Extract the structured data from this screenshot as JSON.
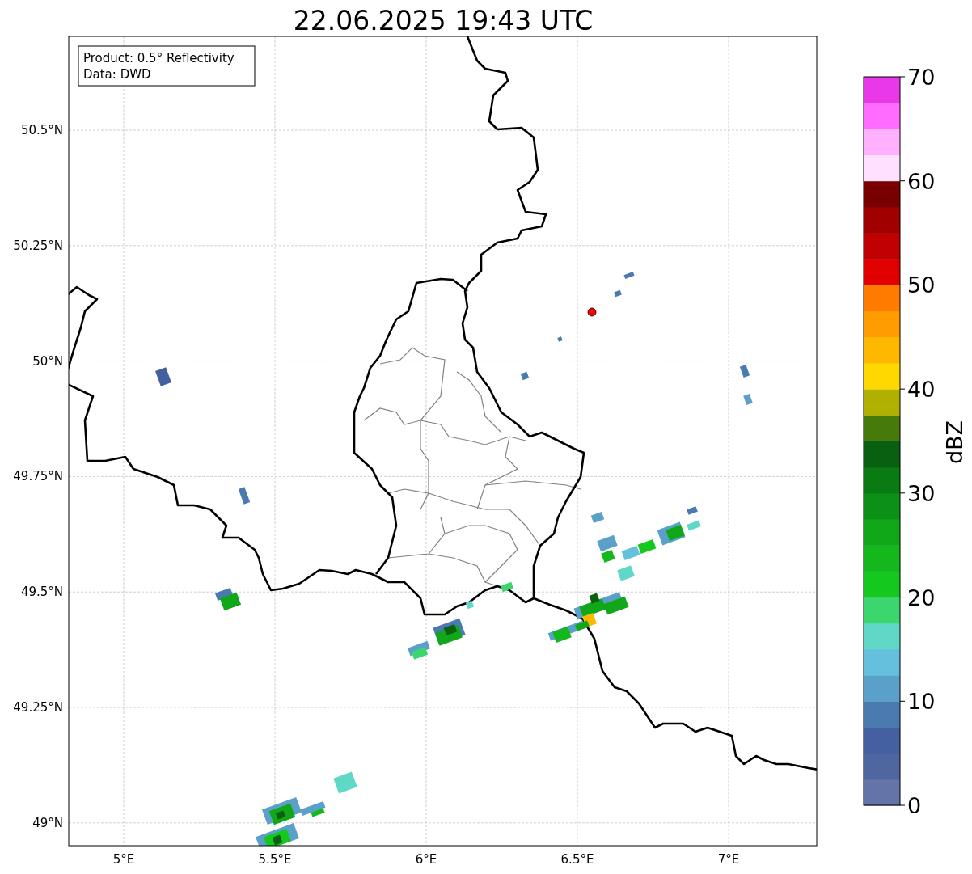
{
  "title": "22.06.2025 19:43 UTC",
  "info_box": [
    "Product: 0.5° Reflectivity",
    "Data: DWD"
  ],
  "lon_ticks": [
    "5°E",
    "5.5°E",
    "6°E",
    "6.5°E",
    "7°E"
  ],
  "lat_ticks": [
    "50.5°N",
    "50.25°N",
    "50°N",
    "49.75°N",
    "49.5°N",
    "49.25°N",
    "49°N"
  ],
  "colorbar": {
    "label": "dBZ",
    "ticks": [
      "70",
      "60",
      "50",
      "40",
      "30",
      "20",
      "10",
      "0"
    ],
    "segments": [
      {
        "color": "#6473a8"
      },
      {
        "color": "#5066a0"
      },
      {
        "color": "#4460a0"
      },
      {
        "color": "#4a7ab0"
      },
      {
        "color": "#5aa0c8"
      },
      {
        "color": "#64c0dc"
      },
      {
        "color": "#60d8c8"
      },
      {
        "color": "#3cd66e"
      },
      {
        "color": "#14c81e"
      },
      {
        "color": "#12b81c"
      },
      {
        "color": "#10a818"
      },
      {
        "color": "#0c9018"
      },
      {
        "color": "#0a7a12"
      },
      {
        "color": "#086010"
      },
      {
        "color": "#467a0a"
      },
      {
        "color": "#b0b000"
      },
      {
        "color": "#ffd800"
      },
      {
        "color": "#ffb800"
      },
      {
        "color": "#ff9c00"
      },
      {
        "color": "#ff7c00"
      },
      {
        "color": "#e00000"
      },
      {
        "color": "#c00000"
      },
      {
        "color": "#a00000"
      },
      {
        "color": "#780000"
      },
      {
        "color": "#ffe0ff"
      },
      {
        "color": "#ffb0ff"
      },
      {
        "color": "#ff6cff"
      },
      {
        "color": "#e838e8"
      }
    ]
  }
}
